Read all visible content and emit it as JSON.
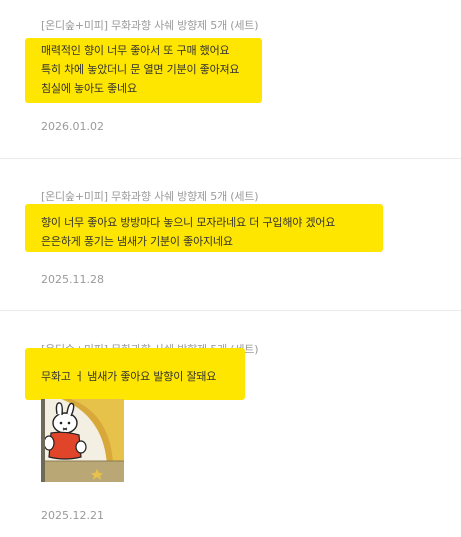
{
  "reviews": [
    {
      "product": "[온디숲+미피] 무화과향 사쉐 방향제 5개 (세트)",
      "lines": [
        "매력적인 향이 너무 좋아서 또 구매 했어요",
        "특히 차에 놓았더니 문 열면 기분이 좋아져요",
        "침실에 놓아도 좋네요"
      ],
      "date": "2026.01.02"
    },
    {
      "product": "[온디숲+미피] 무화과향 사쉐 방향제 5개 (세트)",
      "lines": [
        "향이 너무 좋아요   방방마다 놓으니 모자라네요 더 구입해야 겠어요",
        "은은하게 풍기는 냄새가 기분이 좋아지네요"
      ],
      "date": "2025.11.28"
    },
    {
      "product": "[온디숲+미피] 무화과향 사쉐 방향제 5개 (세트)",
      "lines": [
        "무화고 ㅓ 냄새가 좋아요 발향이 잘돼요"
      ],
      "date": "2025.12.21"
    }
  ],
  "colors": {
    "highlight": "#ffe600",
    "meta_text": "#9a9a9a",
    "body_text": "#333333",
    "divider": "#ececec"
  }
}
